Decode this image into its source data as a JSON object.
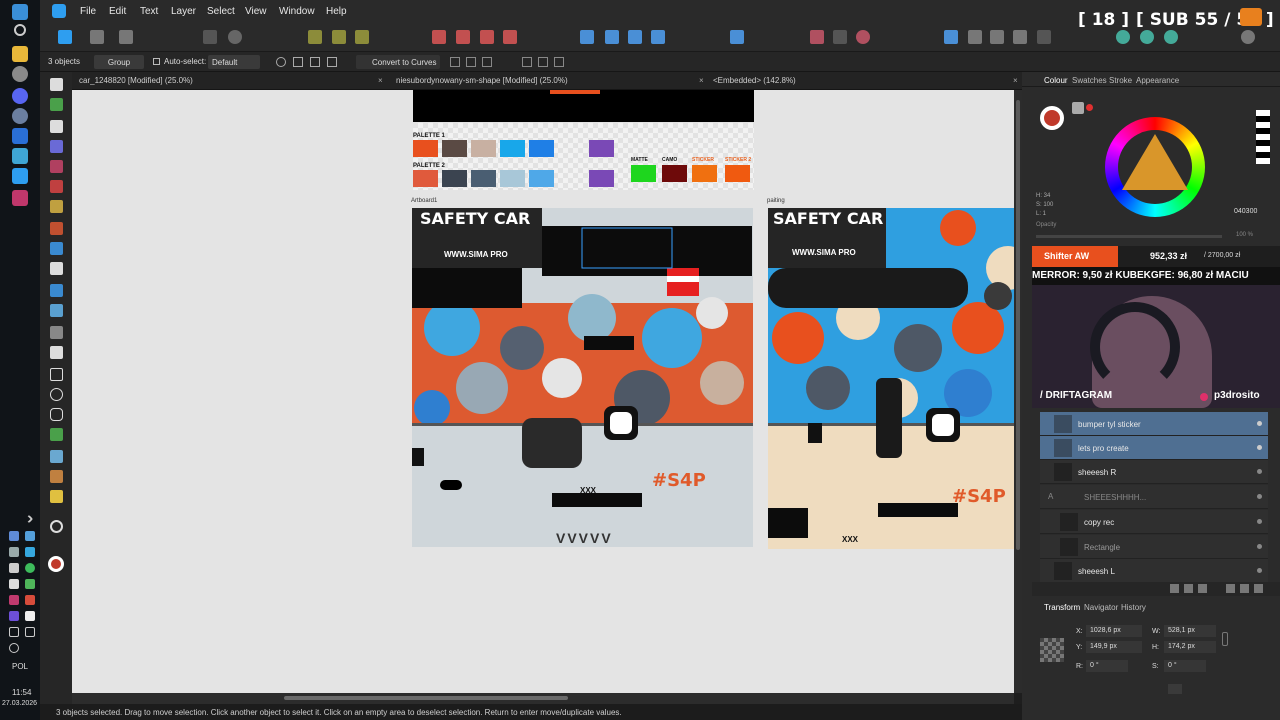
{
  "menu": [
    "File",
    "Edit",
    "Text",
    "Layer",
    "Select",
    "View",
    "Window",
    "Help"
  ],
  "context": {
    "selection_count": "3 objects",
    "group_label": "Group",
    "autoselect_label": "Auto-select:",
    "autoselect_value": "Default",
    "convert_label": "Convert to Curves"
  },
  "tabs": [
    {
      "label": "car_1248820 [Modified] (25.0%)"
    },
    {
      "label": "niesubordynowany-sm-shape [Modified] (25.0%)"
    },
    {
      "label": "<Embedded> (142.8%)"
    }
  ],
  "canvas": {
    "palette1_label": "PALETTE 1",
    "palette2_label": "PALETTE 2",
    "matte_label": "MATTE",
    "camo_label": "CAMO",
    "sticker_label": "STICKER",
    "sticker2_label": "STICKER 2",
    "artboard1_label": "Artboard1",
    "painting_label": "paiting",
    "safety_car": "SAFETY CAR",
    "s4p": "#S4P",
    "xxx": "XXX",
    "vvvvv": "VVVVV",
    "sima_pro": "WWW.SIMA PRO",
    "palette1_colors": [
      "#e8501e",
      "#5a4a44",
      "#c8b0a2",
      "#18a7ea",
      "#1f7fe6",
      "#7a49b6"
    ],
    "palette2_colors": [
      "#e05a3c",
      "#3b4450",
      "#4a5e72",
      "#a8c7d8",
      "#4fa8e8",
      "#7a49b6"
    ],
    "extra_colors": [
      "#1ed61e",
      "#6e0a0a",
      "#f07010",
      "#f05a10"
    ]
  },
  "panel": {
    "tabs": [
      "Colour",
      "Swatches",
      "Stroke",
      "Appearance"
    ],
    "hsl": {
      "h": "H: 34",
      "s": "S: 100",
      "l": "L: 1"
    },
    "hex": "040300",
    "opacity_label": "Opacity",
    "opacity_value": "100 %",
    "layers": [
      "bumper tyl sticker",
      "lets pro create",
      "sheeesh R",
      "SHEEESHHHH...",
      "copy rec",
      "Rectangle",
      "sheeesh L"
    ],
    "transform_tabs": [
      "Transform",
      "Navigator",
      "History"
    ],
    "transform": {
      "x_label": "X:",
      "x": "1028,6 px",
      "y_label": "Y:",
      "y": "149,9 px",
      "w_label": "W:",
      "w": "528,1 px",
      "h_label": "H:",
      "h": "174,2 px",
      "r_label": "R:",
      "r": "0 °",
      "s_label": "S:",
      "s": "0 °"
    }
  },
  "overlay": {
    "counter": "[ 18 ]",
    "subs": "[ SUB 55 / 50 ]",
    "shifter_name": "Shifter AW",
    "money_main": "952,33 zł",
    "money_target": "/ 2700,00 zł",
    "ticker": "MERROR: 9,50 zł  KUBEKGFE: 96,80 zł  MACIU",
    "tiktok": "/ DRIFTAGRAM",
    "insta": "p3drosito"
  },
  "status": {
    "text": "3 objects selected. Drag to move selection. Click another object to select it. Click on an empty area to deselect selection. Return to enter move/duplicate values."
  },
  "system": {
    "lang": "POL",
    "time": "11:54",
    "date": "27.03.2026"
  },
  "colors": {
    "accent": "#4a8fd6",
    "camo_orange": "#e8501e",
    "camo_blue": "#2f9fe0"
  }
}
